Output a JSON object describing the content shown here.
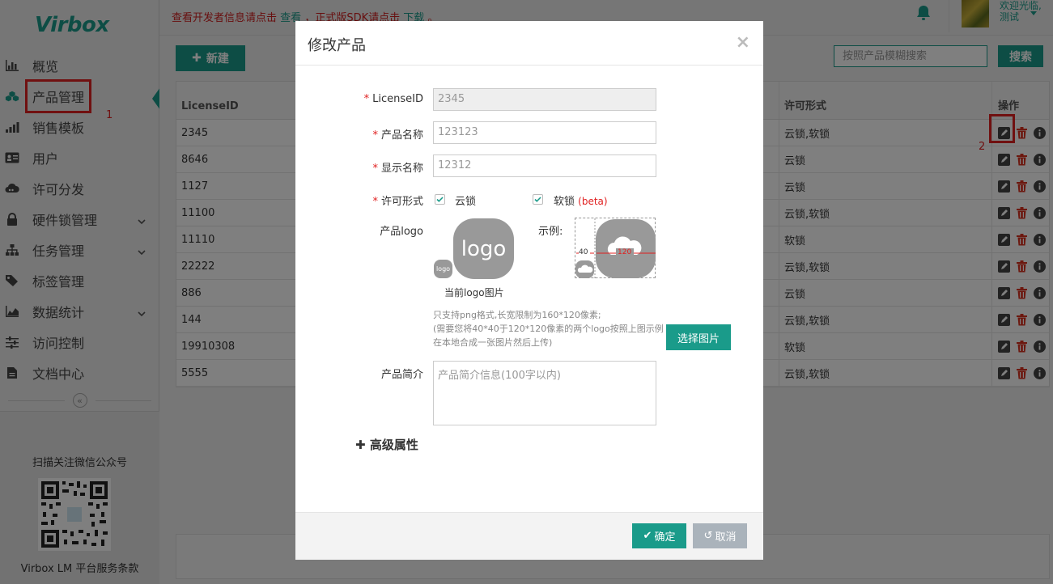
{
  "brand": {
    "name": "Virbox"
  },
  "sidebar": {
    "items": [
      {
        "label": "概览",
        "icon": "bar-chart-icon"
      },
      {
        "label": "产品管理",
        "icon": "cubes-icon",
        "active": true
      },
      {
        "label": "销售模板",
        "icon": "signal-icon"
      },
      {
        "label": "用户",
        "icon": "id-card-icon"
      },
      {
        "label": "许可分发",
        "icon": "cloud-icon"
      },
      {
        "label": "硬件锁管理",
        "icon": "lock-icon",
        "expandable": true
      },
      {
        "label": "任务管理",
        "icon": "sitemap-icon",
        "expandable": true
      },
      {
        "label": "标签管理",
        "icon": "tags-icon"
      },
      {
        "label": "数据统计",
        "icon": "area-chart-icon",
        "expandable": true
      },
      {
        "label": "访问控制",
        "icon": "sliders-icon"
      },
      {
        "label": "文档中心",
        "icon": "file-icon"
      }
    ],
    "annotation_1": "1",
    "wechat_title": "扫描关注微信公众号",
    "terms": "Virbox LM 平台服务条款"
  },
  "topbar": {
    "notice_part1": "查看开发者信息请点击",
    "notice_link1": "查看",
    "notice_part2": "，正式版SDK请点击",
    "notice_link2": "下载",
    "notice_end": "。",
    "welcome_line1": "欢迎光临,",
    "welcome_line2": "测试"
  },
  "toolbar": {
    "new_label": "新建",
    "search_placeholder": "按照产品模糊搜索",
    "search_label": "搜索"
  },
  "table": {
    "headers": {
      "id": "LicenseID",
      "license_form": "许可形式",
      "actions": "操作"
    },
    "rows": [
      {
        "id": "2345",
        "license_form": "云锁,软锁"
      },
      {
        "id": "8646",
        "license_form": "云锁"
      },
      {
        "id": "1127",
        "license_form": "云锁"
      },
      {
        "id": "11100",
        "license_form": "云锁,软锁"
      },
      {
        "id": "11110",
        "license_form": "软锁"
      },
      {
        "id": "22222",
        "license_form": "云锁,软锁"
      },
      {
        "id": "886",
        "license_form": "云锁"
      },
      {
        "id": "144",
        "license_form": "云锁,软锁"
      },
      {
        "id": "19910308",
        "license_form": "软锁"
      },
      {
        "id": "5555",
        "license_form": "云锁,软锁"
      }
    ],
    "annotation_2": "2"
  },
  "modal": {
    "title": "修改产品",
    "close": "×",
    "license_id_label": "LicenseID",
    "license_id_value": "2345",
    "product_name_label": "产品名称",
    "product_name_value": "123123",
    "display_name_label": "显示名称",
    "display_name_value": "12312",
    "license_form_label": "许可形式",
    "cloud_lock_label": "云锁",
    "cloud_lock_checked": true,
    "soft_lock_label": "软锁",
    "soft_lock_checked": true,
    "beta_label": "(beta)",
    "logo_label": "产品logo",
    "logo_big_text": "logo",
    "logo_small_text": "logo",
    "logo_caption": "当前logo图片",
    "example_label": "示例:",
    "example_small_size": "40",
    "example_big_size": "120",
    "hint_line1": "只支持png格式,长宽限制为160*120像素;",
    "hint_line2": "(需要您将40*40于120*120像素的两个logo按照上图示例在本地合成一张图片然后上传)",
    "choose_image_label": "选择图片",
    "intro_label": "产品简介",
    "intro_placeholder": "产品简介信息(100字以内)",
    "advanced_label": "高级属性",
    "ok_label": "确定",
    "cancel_label": "取消"
  },
  "colors": {
    "accent": "#1a9b8a",
    "danger": "#e02020",
    "annotation": "#e02020"
  }
}
